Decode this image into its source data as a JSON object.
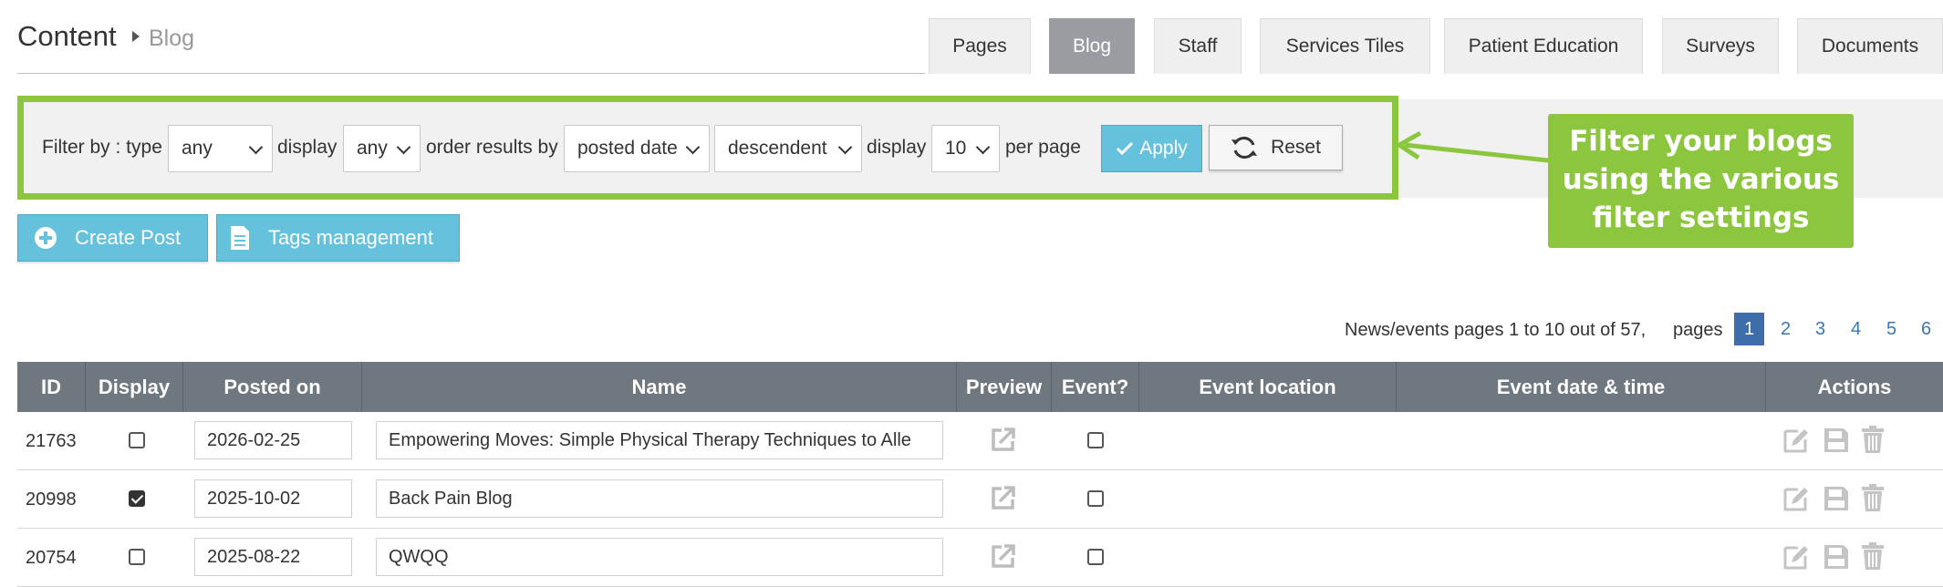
{
  "header": {
    "title": "Content",
    "breadcrumb": "Blog"
  },
  "tabs": [
    {
      "label": "Pages"
    },
    {
      "label": "Blog"
    },
    {
      "label": "Staff"
    },
    {
      "label": "Services Tiles"
    },
    {
      "label": "Patient Education"
    },
    {
      "label": "Surveys"
    },
    {
      "label": "Documents"
    }
  ],
  "filter": {
    "type_label": "Filter by : type",
    "type_value": "any",
    "display_label": "display",
    "display_value": "any",
    "order_label": "order results by",
    "order_value": "posted date",
    "direction_value": "descendent",
    "perpage_label_pre": "display",
    "perpage_value": "10",
    "perpage_label_post": "per page",
    "apply_label": "Apply",
    "reset_label": "Reset"
  },
  "callout": {
    "line1": "Filter your blogs",
    "line2": "using the various",
    "line3": "filter settings"
  },
  "actions": {
    "create_label": "Create Post",
    "tags_label": "Tags management"
  },
  "pagination": {
    "info": "News/events pages 1 to 10 out of 57,",
    "label": "pages",
    "pages": [
      "1",
      "2",
      "3",
      "4",
      "5",
      "6"
    ],
    "current": "1"
  },
  "table": {
    "columns": [
      "ID",
      "Display",
      "Posted on",
      "Name",
      "Preview",
      "Event?",
      "Event location",
      "Event date & time",
      "Actions"
    ],
    "rows": [
      {
        "id": "21763",
        "display": false,
        "posted_on": "2026-02-25",
        "name": "Empowering Moves: Simple Physical Therapy Techniques to Alle",
        "event": false
      },
      {
        "id": "20998",
        "display": true,
        "posted_on": "2025-10-02",
        "name": "Back Pain Blog",
        "event": false
      },
      {
        "id": "20754",
        "display": false,
        "posted_on": "2025-08-22",
        "name": "QWQQ",
        "event": false
      }
    ]
  },
  "icons": {
    "breadcrumb": "caret-right-icon",
    "apply": "checkmark-icon",
    "reset": "refresh-icon",
    "create": "plus-circle-icon",
    "tags": "document-icon",
    "preview": "external-link-icon",
    "edit": "edit-icon",
    "save": "save-icon",
    "delete": "trash-icon"
  },
  "colors": {
    "accent_green": "#8cc63f",
    "button_blue": "#66c1dc",
    "header_gray": "#6f777f",
    "active_tab": "#999da1",
    "page_active": "#3e6ea9"
  }
}
